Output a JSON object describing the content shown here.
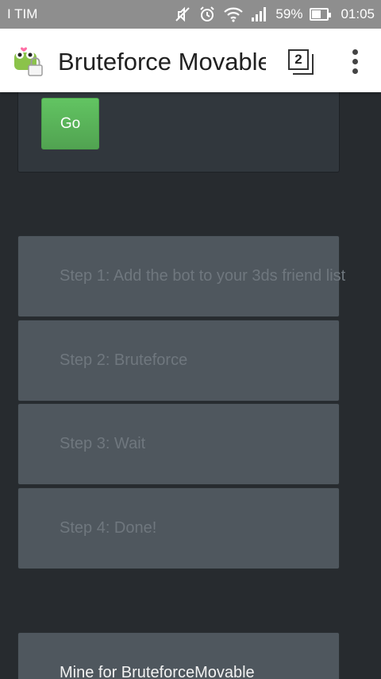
{
  "status_bar": {
    "carrier": "I TIM",
    "battery_percent": "59%",
    "battery_level": 0.59,
    "time": "01:05",
    "icons": [
      "mute-icon",
      "alarm-icon",
      "wifi-icon",
      "signal-icon",
      "battery-icon"
    ]
  },
  "app_bar": {
    "title": "Bruteforce Movable",
    "tab_count": "2",
    "icon": "app-frog-lock-icon",
    "menu_icon": "overflow-menu-icon"
  },
  "form": {
    "go_label": "Go"
  },
  "steps": [
    {
      "label": "Step 1: Add the bot to your 3ds friend list"
    },
    {
      "label": "Step 2: Bruteforce"
    },
    {
      "label": "Step 3: Wait"
    },
    {
      "label": "Step 4: Done!"
    }
  ],
  "mine": {
    "label": "Mine for BruteforceMovable"
  },
  "colors": {
    "background": "#272b2f",
    "card": "#31373d",
    "step_card": "#4f575e",
    "step_text_disabled": "#6f777e",
    "go_button": "#5cb85c",
    "status_bar": "#8e8e8e",
    "app_bar": "#ffffff"
  }
}
